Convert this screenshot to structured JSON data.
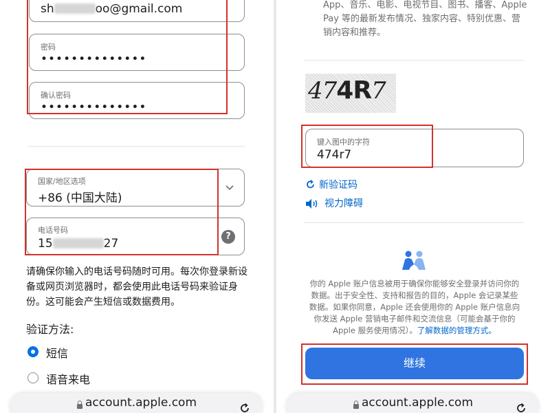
{
  "left": {
    "email": {
      "value_prefix": "sh",
      "value_suffix": "oo@gmail.com"
    },
    "password": {
      "label": "密码",
      "value": "••••••••••••••"
    },
    "confirm_password": {
      "label": "确认密码",
      "value": "••••••••••••••"
    },
    "country": {
      "label": "国家/地区选项",
      "value": "+86 (中国大陆)"
    },
    "phone": {
      "label": "电话号码",
      "value_prefix": "15",
      "value_suffix": "27"
    },
    "phone_note": "请确保你输入的电话号码随时可用。每次你登录新设备或网页浏览器时，都会使用此电话号码来验证身份。这可能会产生短信或数据费用。",
    "verify_title": "验证方法:",
    "verify_options": [
      "短信",
      "语音来电"
    ],
    "url": "account.apple.com"
  },
  "right": {
    "marketing_text": "App、音乐、电影、电视节目、图书、播客、Apple Pay 等的最新发布情况、独家内容、特别优惠、营销内容和推荐。",
    "captcha_text": [
      "47",
      "4",
      "R",
      "7"
    ],
    "captcha_input": {
      "label": "键入图中的字符",
      "value": "474r7"
    },
    "new_code_link": "新验证码",
    "vision_link": "视力障碍",
    "privacy_text": "你的 Apple 账户信息被用于确保你能够安全登录并访问你的数据。出于安全性、支持和报告的目的，Apple 会记录某些数据。如果你同意，Apple 还会使用你的 Apple 账户信息向你发送 Apple 营销电子邮件和交流信息（可能会基于你的 Apple 服务使用情况）。",
    "privacy_link": "了解数据的管理方式。",
    "continue_label": "继续",
    "url": "account.apple.com"
  },
  "colors": {
    "accent": "#0071e3",
    "button": "#2f74e0",
    "highlight": "#d1312b"
  },
  "icons": [
    "chevron-down-icon",
    "help-icon",
    "refresh-icon",
    "speaker-icon",
    "people-icon",
    "lock-icon",
    "reload-icon"
  ]
}
